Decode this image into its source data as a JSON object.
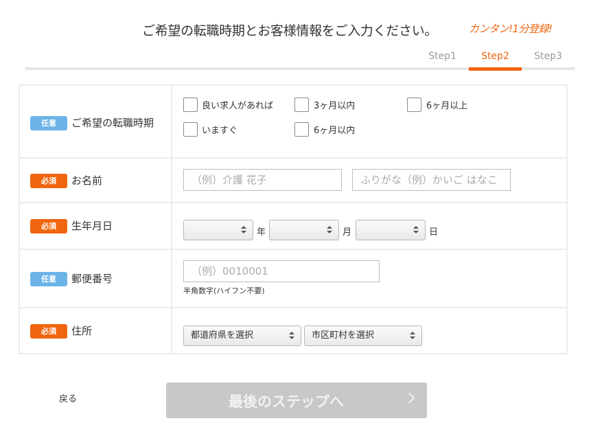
{
  "header": {
    "title": "ご希望の転職時期とお客様情報をご入力ください。",
    "tagline": "カンタン!1分登録!"
  },
  "steps": [
    {
      "label": "Step1",
      "active": false
    },
    {
      "label": "Step2",
      "active": true
    },
    {
      "label": "Step3",
      "active": false
    }
  ],
  "form": {
    "timing": {
      "badge": "任意",
      "label": "ご希望の転職時期",
      "options": [
        "良い求人があれば",
        "3ヶ月以内",
        "6ヶ月以上",
        "いますぐ",
        "6ヶ月以内"
      ]
    },
    "name": {
      "badge": "必須",
      "label": "お名前",
      "name_placeholder": "（例）介護 花子",
      "kana_placeholder": "ふりがな（例）かいご はなこ"
    },
    "birthday": {
      "badge": "必須",
      "label": "生年月日",
      "year_value": "",
      "month_value": "",
      "day_value": "",
      "year_unit": "年",
      "month_unit": "月",
      "day_unit": "日"
    },
    "postal": {
      "badge": "任意",
      "label": "郵便番号",
      "placeholder": "（例）0010001",
      "hint": "半角数字(ハイフン不要)"
    },
    "address": {
      "badge": "必須",
      "label": "住所",
      "prefecture_value": "都道府県を選択",
      "city_value": "市区町村を選択"
    }
  },
  "footer": {
    "back_label": "戻る",
    "next_label": "最後のステップへ",
    "next_icon": "chevron-right-icon"
  },
  "colors": {
    "accent": "#f0650e",
    "optional_badge": "#6cb4e8",
    "required_badge": "#f0650e",
    "disabled_button": "#c8c8c8"
  }
}
